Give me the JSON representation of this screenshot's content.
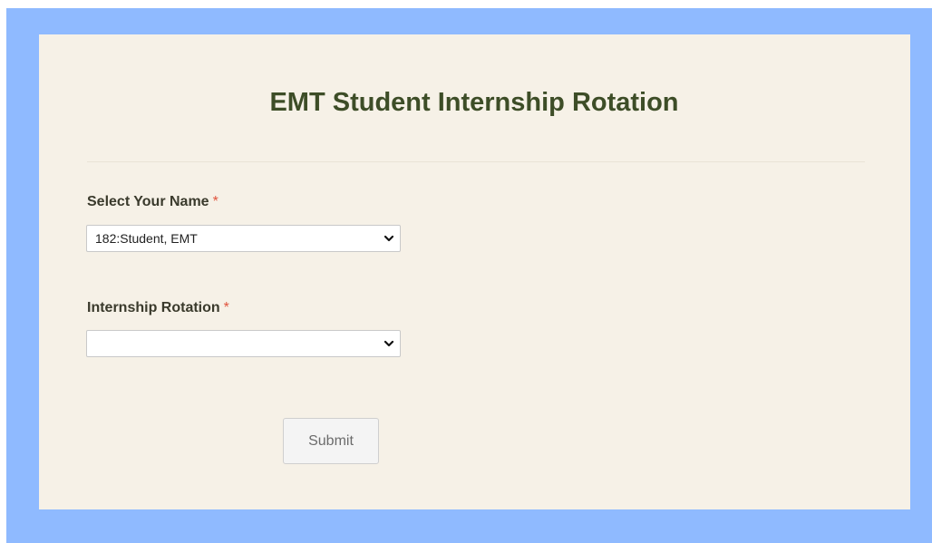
{
  "form": {
    "title": "EMT Student Internship Rotation",
    "submit_label": "Submit"
  },
  "fields": {
    "name": {
      "label": "Select Your Name",
      "required_marker": "*",
      "selected_value": "182:Student, EMT"
    },
    "rotation": {
      "label": "Internship Rotation",
      "required_marker": "*",
      "selected_value": ""
    }
  },
  "icons": {
    "dropdown": "chevron-down-icon"
  },
  "colors": {
    "page_background": "#8fbaff",
    "card_background": "#f6f1e7",
    "title_color": "#3d4d27",
    "required_color": "#e0533d"
  }
}
